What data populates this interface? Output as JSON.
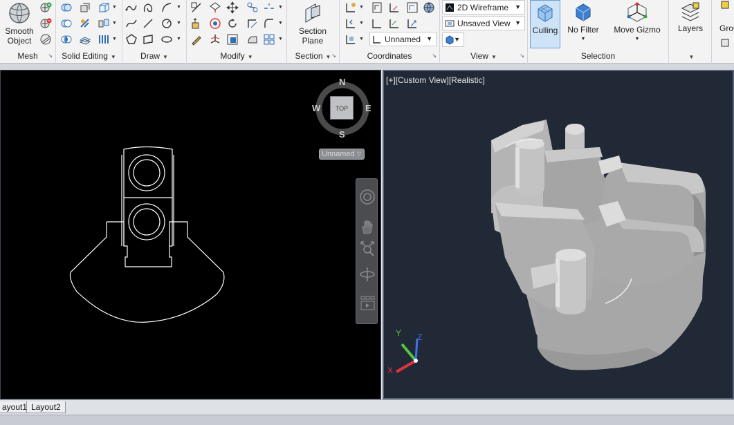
{
  "ribbon": {
    "mesh": {
      "title": "Mesh",
      "smooth_object_line1": "Smooth",
      "smooth_object_line2": "Object"
    },
    "solid_editing": {
      "title": "Solid Editing"
    },
    "draw": {
      "title": "Draw"
    },
    "modify": {
      "title": "Modify"
    },
    "section": {
      "title": "Section",
      "section_plane_line1": "Section",
      "section_plane_line2": "Plane"
    },
    "coordinates": {
      "title": "Coordinates",
      "ucs_combo": "Unnamed"
    },
    "view": {
      "title": "View",
      "visual_style": "2D Wireframe",
      "named_view": "Unsaved View"
    },
    "selection": {
      "title": "Selection",
      "culling": "Culling",
      "no_filter": "No Filter",
      "move_gizmo": "Move Gizmo"
    },
    "layers": {
      "title": "Layers",
      "cut_label": "Grou"
    }
  },
  "left_viewport": {
    "viewcube": {
      "north": "N",
      "south": "S",
      "east": "E",
      "west": "W",
      "face": "TOP",
      "ucs_menu": "Unnamed"
    }
  },
  "right_viewport": {
    "label": "[+][Custom View][Realistic]",
    "ucs_axes": {
      "x": "X",
      "y": "Y",
      "z": "Z"
    }
  },
  "layout_tabs": [
    "ayout1",
    "Layout2"
  ],
  "colors": {
    "ribbon_bg": "#f3f3f3",
    "model_bg_2d": "#000000",
    "model_bg_3d": "#222936",
    "solid_gray": "#b4b4b4",
    "axis_x": "#e0353d",
    "axis_y": "#53c640",
    "axis_z": "#3c73e8",
    "culling_active": "#cfe3f7"
  }
}
